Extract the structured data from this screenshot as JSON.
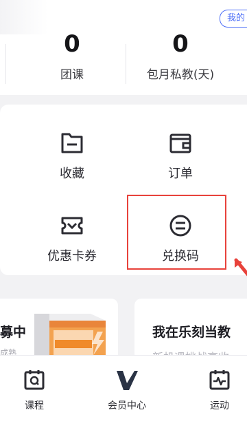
{
  "header": {
    "badge": "我的"
  },
  "stats": [
    {
      "value": "0",
      "label": "团课"
    },
    {
      "value": "0",
      "label": "包月私教(天)"
    }
  ],
  "grid": [
    {
      "label": "收藏",
      "icon": "folder-icon"
    },
    {
      "label": "订单",
      "icon": "wallet-icon"
    },
    {
      "label": "优惠卡券",
      "icon": "ticket-icon"
    },
    {
      "label": "兑换码",
      "icon": "redeem-code-icon"
    }
  ],
  "promo": [
    {
      "title": "募中",
      "subtitle": "成熟"
    },
    {
      "title": "我在乐刻当教",
      "subtitle": "新机遇挑战高收"
    }
  ],
  "tabs": [
    {
      "label": "课程",
      "icon": "course-icon"
    },
    {
      "label": "会员中心",
      "icon": "member-v-icon"
    },
    {
      "label": "运动",
      "icon": "exercise-icon"
    }
  ],
  "colors": {
    "accent": "#4a6cf7",
    "highlight": "#e8423b",
    "promo_orange": "#f08a2a"
  }
}
